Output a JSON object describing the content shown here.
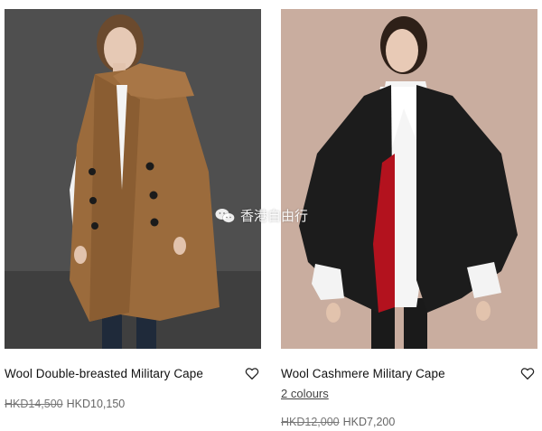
{
  "products": [
    {
      "name": "Wool Double-breasted Military Cape",
      "colours_link": "",
      "old_price": "HKD14,500",
      "new_price": "HKD10,150",
      "image_bg": "#4f4f4f",
      "garment_color": "#9b6b3c"
    },
    {
      "name": "Wool Cashmere Military Cape",
      "colours_link": "2 colours",
      "old_price": "HKD12,000",
      "new_price": "HKD7,200",
      "image_bg": "#c9ad9f",
      "garment_color": "#1c1c1c",
      "lining_color": "#b3121e"
    }
  ],
  "watermark": {
    "text": "香港自由行",
    "icon": "wechat-icon"
  },
  "icons": {
    "wishlist": "heart-outline-icon"
  }
}
